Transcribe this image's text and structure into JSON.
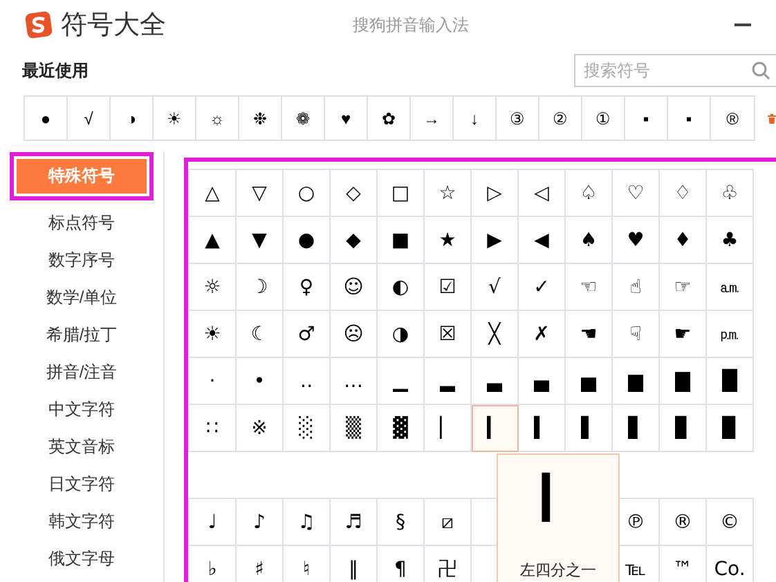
{
  "window": {
    "title": "符号大全",
    "subtitle": "搜狗拼音输入法"
  },
  "recent": {
    "label": "最近使用",
    "symbols": [
      "●",
      "√",
      "◑",
      "☀",
      "☼",
      "❉",
      "❁",
      "♥",
      "✿",
      "→",
      "↓",
      "③",
      "②",
      "①",
      "▪",
      "▪",
      "®"
    ]
  },
  "search": {
    "placeholder": "搜索符号"
  },
  "categories": [
    {
      "label": "特殊符号",
      "selected": true
    },
    {
      "label": "标点符号",
      "selected": false
    },
    {
      "label": "数字序号",
      "selected": false
    },
    {
      "label": "数学/单位",
      "selected": false
    },
    {
      "label": "希腊/拉丁",
      "selected": false
    },
    {
      "label": "拼音/注音",
      "selected": false
    },
    {
      "label": "中文字符",
      "selected": false
    },
    {
      "label": "英文音标",
      "selected": false
    },
    {
      "label": "日文字符",
      "selected": false
    },
    {
      "label": "韩文字符",
      "selected": false
    },
    {
      "label": "俄文字母",
      "selected": false
    }
  ],
  "sections": [
    {
      "rows": [
        [
          {
            "s": "△",
            "highlighted": false
          },
          {
            "s": "▽",
            "highlighted": false
          },
          {
            "s": "○",
            "highlighted": false
          },
          {
            "s": "◇",
            "highlighted": false
          },
          {
            "s": "□",
            "highlighted": false
          },
          {
            "s": "☆",
            "highlighted": false
          },
          {
            "s": "▷",
            "highlighted": false
          },
          {
            "s": "◁",
            "highlighted": false
          },
          {
            "s": "♤",
            "highlighted": false
          },
          {
            "s": "♡",
            "highlighted": false
          },
          {
            "s": "♢",
            "highlighted": false
          },
          {
            "s": "♧",
            "highlighted": false
          }
        ],
        [
          {
            "s": "▲",
            "highlighted": false
          },
          {
            "s": "▼",
            "highlighted": false
          },
          {
            "s": "●",
            "highlighted": false
          },
          {
            "s": "◆",
            "highlighted": false
          },
          {
            "s": "■",
            "highlighted": false
          },
          {
            "s": "★",
            "highlighted": false
          },
          {
            "s": "▶",
            "highlighted": false
          },
          {
            "s": "◀",
            "highlighted": false
          },
          {
            "s": "♠",
            "highlighted": false
          },
          {
            "s": "♥",
            "highlighted": false
          },
          {
            "s": "♦",
            "highlighted": false
          },
          {
            "s": "♣",
            "highlighted": false
          }
        ],
        [
          {
            "s": "☼",
            "highlighted": false
          },
          {
            "s": "☽",
            "highlighted": false
          },
          {
            "s": "♀",
            "highlighted": false
          },
          {
            "s": "☺",
            "highlighted": false
          },
          {
            "s": "◐",
            "highlighted": false
          },
          {
            "s": "☑",
            "highlighted": false
          },
          {
            "s": "√",
            "highlighted": false
          },
          {
            "s": "✓",
            "highlighted": false
          },
          {
            "s": "☜",
            "highlighted": false
          },
          {
            "s": "☝",
            "highlighted": false
          },
          {
            "s": "☞",
            "highlighted": false
          },
          {
            "s": "㏂",
            "highlighted": false
          }
        ],
        [
          {
            "s": "☀",
            "highlighted": false
          },
          {
            "s": "☾",
            "highlighted": false
          },
          {
            "s": "♂",
            "highlighted": false
          },
          {
            "s": "☹",
            "highlighted": false
          },
          {
            "s": "◑",
            "highlighted": false
          },
          {
            "s": "☒",
            "highlighted": false
          },
          {
            "s": "╳",
            "highlighted": false
          },
          {
            "s": "✗",
            "highlighted": false
          },
          {
            "s": "☚",
            "highlighted": false
          },
          {
            "s": "☟",
            "highlighted": false
          },
          {
            "s": "☛",
            "highlighted": false
          },
          {
            "s": "㏘",
            "highlighted": false
          }
        ],
        [
          {
            "s": "·",
            "highlighted": false
          },
          {
            "s": "•",
            "highlighted": false
          },
          {
            "s": "‥",
            "highlighted": false
          },
          {
            "s": "…",
            "highlighted": false
          },
          {
            "s": "▁",
            "highlighted": false
          },
          {
            "s": "▂",
            "highlighted": false
          },
          {
            "s": "▃",
            "highlighted": false
          },
          {
            "s": "▄",
            "highlighted": false
          },
          {
            "s": "▅",
            "highlighted": false
          },
          {
            "s": "▆",
            "highlighted": false
          },
          {
            "s": "▇",
            "highlighted": false
          },
          {
            "s": "█",
            "highlighted": false
          }
        ],
        [
          {
            "s": "∷",
            "highlighted": false
          },
          {
            "s": "※",
            "highlighted": false
          },
          {
            "s": "░",
            "highlighted": false
          },
          {
            "s": "▒",
            "highlighted": false
          },
          {
            "s": "▓",
            "highlighted": false
          },
          {
            "s": "▏",
            "highlighted": false
          },
          {
            "s": "▎",
            "highlighted": true
          },
          {
            "s": "▍",
            "highlighted": false
          },
          {
            "s": "▌",
            "highlighted": false
          },
          {
            "s": "▋",
            "highlighted": false
          },
          {
            "s": "▊",
            "highlighted": false
          },
          {
            "s": "▉",
            "highlighted": false
          }
        ]
      ]
    },
    {
      "rows": [
        [
          {
            "s": "♩",
            "highlighted": false
          },
          {
            "s": "♪",
            "highlighted": false
          },
          {
            "s": "♫",
            "highlighted": false
          },
          {
            "s": "♬",
            "highlighted": false
          },
          {
            "s": "§",
            "highlighted": false
          },
          {
            "s": "⧄",
            "highlighted": false
          },
          null,
          null,
          null,
          {
            "s": "℗",
            "highlighted": false
          },
          {
            "s": "®",
            "highlighted": false
          },
          {
            "s": "©",
            "highlighted": false
          }
        ],
        [
          {
            "s": "♭",
            "highlighted": false
          },
          {
            "s": "♯",
            "highlighted": false
          },
          {
            "s": "♮",
            "highlighted": false
          },
          {
            "s": "‖",
            "highlighted": false
          },
          {
            "s": "¶",
            "highlighted": false
          },
          {
            "s": "卍",
            "highlighted": false
          },
          null,
          null,
          null,
          {
            "s": "℡",
            "highlighted": false
          },
          {
            "s": "™",
            "highlighted": false
          },
          {
            "s": "Co.",
            "highlighted": false
          }
        ]
      ]
    }
  ],
  "tooltip": {
    "symbol": "▎",
    "label": "左四分之一"
  }
}
